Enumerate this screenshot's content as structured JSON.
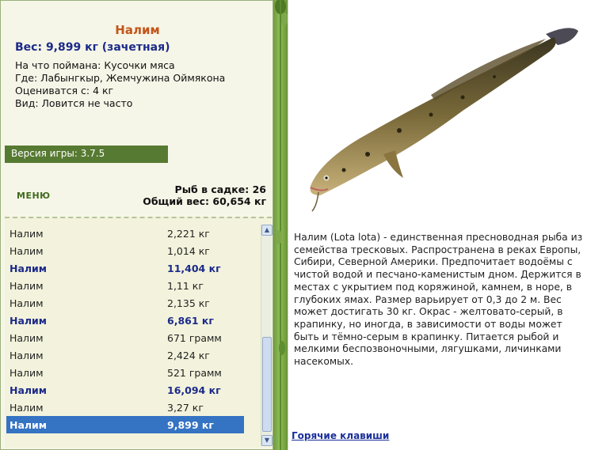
{
  "fish": {
    "title": "Налим",
    "weight_line": "Вес: 9,899 кг (зачетная)",
    "caught_on": "На что поймана: Кусочки мяса",
    "location": "Где: Лабынгкыр, Жемчужина Оймякона",
    "valued_from": "Оцениватся с: 4 кг",
    "frequency": "Вид: Ловится не часто",
    "description": "Налим (Lota lota) - единственная пресноводная рыба из семейства тресковых. Распространена в реках Европы, Сибири, Северной Америки. Предпочитает водоёмы с чистой водой и песчано-каменистым дном. Держится в местах с укрытием под коряжиной, камнем, в норе, в глубоких ямах. Размер варьирует от 0,3 до 2 м. Вес может достигать 30 кг. Окрас - желтовато-серый, в крапинку, но иногда, в зависимости от воды может быть и тёмно-серым в крапинку. Питается рыбой и мелкими беспозвоночными, лягушками, личинками насекомых."
  },
  "version": "Версия игры: 3.7.5",
  "menu_label": "МЕНЮ",
  "tank": {
    "count_line": "Рыб в садке: 26",
    "total_line": "Общий вес: 60,654 кг"
  },
  "catch_list": [
    {
      "name": "Налим",
      "weight": "2,221 кг",
      "trophy": false,
      "selected": false
    },
    {
      "name": "Налим",
      "weight": "1,014 кг",
      "trophy": false,
      "selected": false
    },
    {
      "name": "Налим",
      "weight": "11,404 кг",
      "trophy": true,
      "selected": false
    },
    {
      "name": "Налим",
      "weight": "1,11 кг",
      "trophy": false,
      "selected": false
    },
    {
      "name": "Налим",
      "weight": "2,135 кг",
      "trophy": false,
      "selected": false
    },
    {
      "name": "Налим",
      "weight": "6,861 кг",
      "trophy": true,
      "selected": false
    },
    {
      "name": "Налим",
      "weight": "671 грамм",
      "trophy": false,
      "selected": false
    },
    {
      "name": "Налим",
      "weight": "2,424 кг",
      "trophy": false,
      "selected": false
    },
    {
      "name": "Налим",
      "weight": "521 грамм",
      "trophy": false,
      "selected": false
    },
    {
      "name": "Налим",
      "weight": "16,094 кг",
      "trophy": true,
      "selected": false
    },
    {
      "name": "Налим",
      "weight": "3,27 кг",
      "trophy": false,
      "selected": false
    },
    {
      "name": "Налим",
      "weight": "9,899 кг",
      "trophy": true,
      "selected": true
    }
  ],
  "hotkeys_label": "Горячие клавиши",
  "icons": {
    "scroll_up": "triangle-up",
    "scroll_down": "triangle-down"
  },
  "colors": {
    "title": "#c2551a",
    "trophy": "#1c2a8a",
    "selection": "#3573c3",
    "version_bar": "#577a32"
  }
}
